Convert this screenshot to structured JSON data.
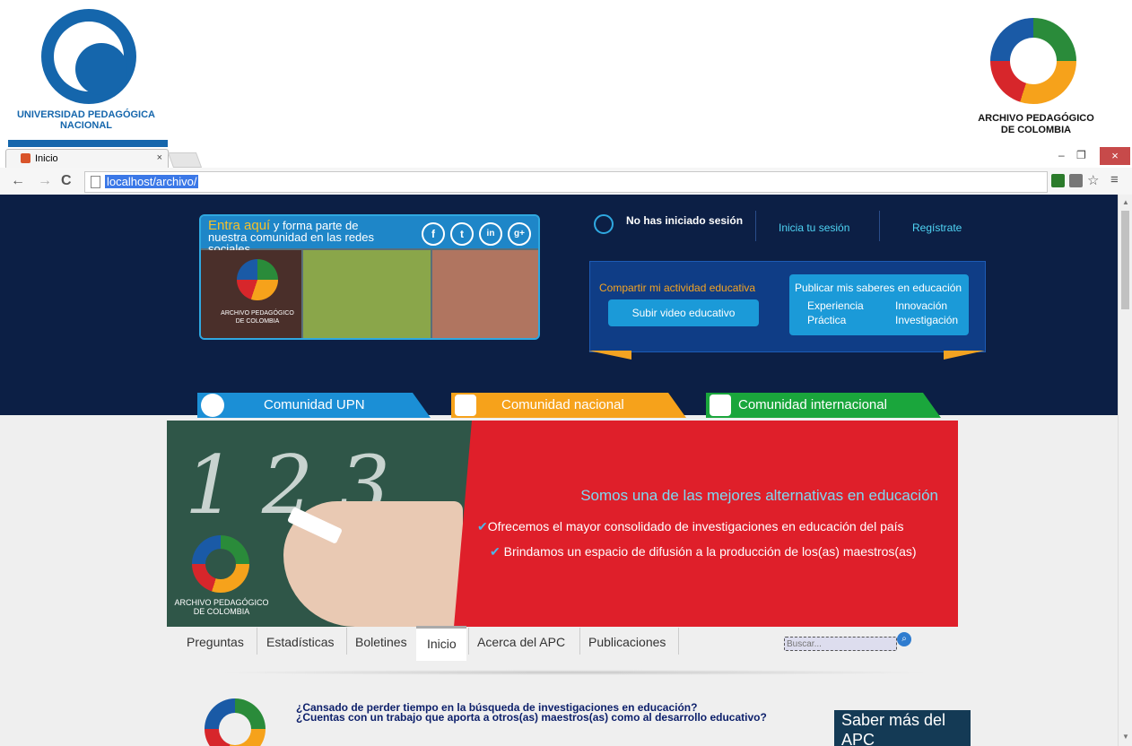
{
  "logos": {
    "upn_line1": "UNIVERSIDAD PEDAGÓGICA",
    "upn_line2": "NACIONAL",
    "apc_line1": "ARCHIVO PEDAGÓGICO",
    "apc_line2": "DE COLOMBIA"
  },
  "browser": {
    "tab_title": "Inicio",
    "tab_close": "×",
    "url": "localhost/archivo/",
    "minimize": "–",
    "restore": "❐",
    "close": "×"
  },
  "social": {
    "lead": "Entra aquí",
    "text": " y forma parte de nuestra comunidad en las redes sociales",
    "icons": [
      "f",
      "t",
      "in",
      "g+"
    ],
    "logo_line1": "ARCHIVO PEDAGÓGICO",
    "logo_line2": "DE COLOMBIA"
  },
  "session": {
    "status": "No has iniciado sesión",
    "login": "Inicia tu sesión",
    "register": "Regístrate"
  },
  "share": {
    "title": "Compartir mi actividad educativa",
    "button": "Subir video educativo",
    "pub_title": "Publicar mis saberes en educación",
    "items": [
      "Experiencia",
      "Innovación",
      "Práctica",
      "Investigación"
    ]
  },
  "community_tabs": [
    "Comunidad UPN",
    "Comunidad nacional",
    "Comunidad internacional"
  ],
  "banner": {
    "title": "Somos una de las mejores alternativas en educación",
    "line1": "Ofrecemos el mayor consolidado de investigaciones  en educación del país",
    "line2": "Brindamos un espacio de difusión a la producción de los(as) maestros(as)",
    "logo_line1": "ARCHIVO PEDAGÓGICO",
    "logo_line2": "DE COLOMBIA",
    "digits": "1 2 3"
  },
  "menu": [
    "Preguntas",
    "Estadísticas",
    "Boletines",
    "Inicio",
    "Acerca del APC",
    "Publicaciones"
  ],
  "search": {
    "placeholder": "Buscar..."
  },
  "bottom": {
    "line1": "¿Cansado de perder tiempo en la búsqueda de investigaciones en educación?",
    "line2": "¿Cuentas con un trabajo que aporta a otros(as) maestros(as) como al desarrollo educativo?",
    "saber": "Saber más del APC"
  },
  "colors": {
    "header_bg": "#0c1f45",
    "accent": "#2fa8e0",
    "upn_blue": "#1566ac",
    "banner_red": "#df1f2a"
  }
}
